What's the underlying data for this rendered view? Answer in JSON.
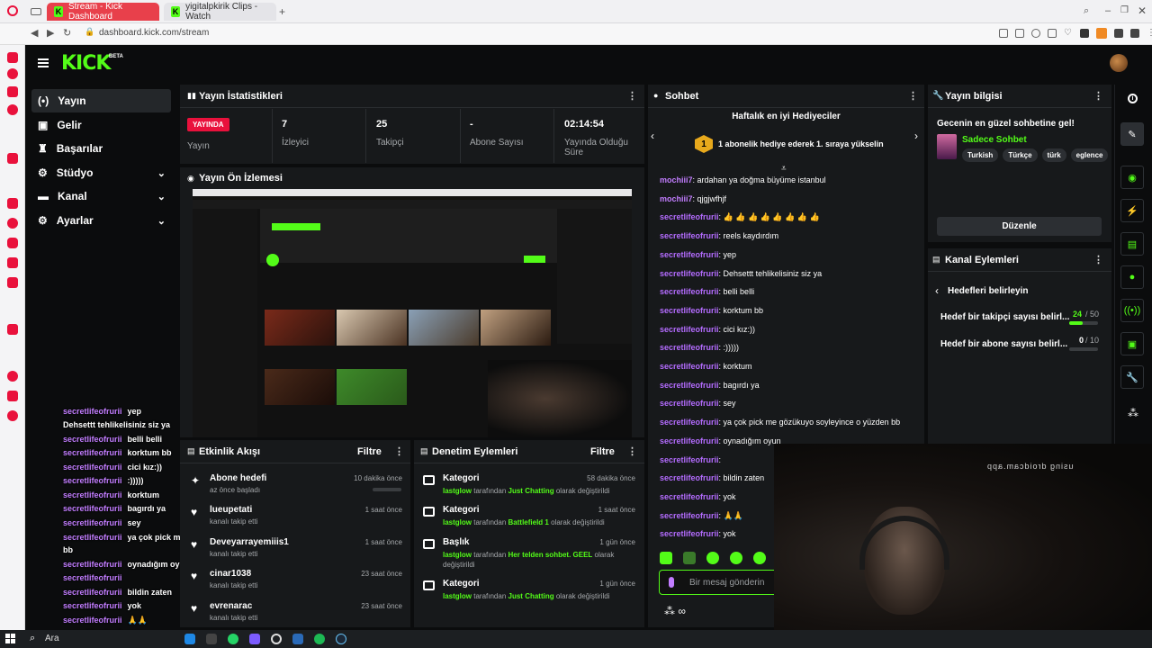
{
  "browser": {
    "tabs": [
      {
        "label": "Stream - Kick Dashboard",
        "active": true
      },
      {
        "label": "yigitalpkirik Clips - Watch"
      }
    ],
    "url": "dashboard.kick.com/stream"
  },
  "brand": {
    "logo": "KICK",
    "beta": "BETA",
    "accent": "#53fc18"
  },
  "nav": {
    "items": [
      {
        "label": "Yayın",
        "icon": "broadcast-icon",
        "active": true
      },
      {
        "label": "Gelir",
        "icon": "money-icon"
      },
      {
        "label": "Başarılar",
        "icon": "trophy-icon"
      },
      {
        "label": "Stüdyo",
        "icon": "gear-icon",
        "expand": true
      },
      {
        "label": "Kanal",
        "icon": "channel-icon",
        "expand": true
      },
      {
        "label": "Ayarlar",
        "icon": "settings-icon",
        "expand": true
      }
    ]
  },
  "stats": {
    "title": "Yayın İstatistikleri",
    "live_badge": "YAYINDA",
    "items": [
      {
        "value": "",
        "label": "Yayın"
      },
      {
        "value": "7",
        "label": "İzleyici"
      },
      {
        "value": "25",
        "label": "Takipçi"
      },
      {
        "value": "-",
        "label": "Abone Sayısı"
      },
      {
        "value": "02:14:54",
        "label": "Yayında Olduğu Süre"
      }
    ]
  },
  "preview": {
    "title": "Yayın Ön İzlemesi"
  },
  "activity": {
    "title": "Etkinlik Akışı",
    "filter": "Filtre",
    "events": [
      {
        "title": "Abone hedefi",
        "sub": "az önce başladı",
        "time": "10 dakika önce",
        "icon": "sparkle-icon"
      },
      {
        "title": "lueupetati",
        "sub": "kanalı takip etti",
        "time": "1 saat önce",
        "icon": "heart-icon"
      },
      {
        "title": "Deveyarrayemiiis1",
        "sub": "kanalı takip etti",
        "time": "1 saat önce",
        "icon": "heart-icon"
      },
      {
        "title": "cinar1038",
        "sub": "kanalı takip etti",
        "time": "23 saat önce",
        "icon": "heart-icon"
      },
      {
        "title": "evrenarac",
        "sub": "kanalı takip etti",
        "time": "23 saat önce",
        "icon": "heart-icon"
      }
    ]
  },
  "moderation": {
    "title": "Denetim Eylemleri",
    "filter": "Filtre",
    "items": [
      {
        "title": "Kategori",
        "time": "58 dakika önce",
        "user": "lastglow",
        "mid": "tarafından",
        "val": "Just Chatting",
        "end": "olarak değiştirildi"
      },
      {
        "title": "Kategori",
        "time": "1 saat önce",
        "user": "lastglow",
        "mid": "tarafından",
        "val": "Battlefield 1",
        "end": "olarak değiştirildi"
      },
      {
        "title": "Başlık",
        "time": "1 gün önce",
        "user": "lastglow",
        "mid": "tarafından",
        "val": "Her telden sohbet. GEEL",
        "end": "olarak değiştirildi"
      },
      {
        "title": "Kategori",
        "time": "1 gün önce",
        "user": "lastglow",
        "mid": "tarafından",
        "val": "Just Chatting",
        "end": "olarak değiştirildi"
      }
    ]
  },
  "chat": {
    "title": "Sohbet",
    "gifters_title": "Haftalık en iyi Hediyeciler",
    "gifters_rank": "1",
    "gifters_text": "1 abonelik hediye ederek 1. sıraya yükselin",
    "messages": [
      {
        "user": "mochiii7",
        "text": "ardahan ya doğma büyüme istanbul",
        "color": "#c27dff"
      },
      {
        "user": "mochiii7",
        "text": "qjgjwfhjf",
        "color": "#c27dff"
      },
      {
        "user": "secretlifeofrurii",
        "text": "👍 👍 👍 👍 👍 👍 👍 👍",
        "color": "#b46cff"
      },
      {
        "user": "secretlifeofrurii",
        "text": "reels kaydırdım",
        "color": "#b46cff"
      },
      {
        "user": "secretlifeofrurii",
        "text": "yep",
        "color": "#b46cff"
      },
      {
        "user": "secretlifeofrurii",
        "text": "Dehsettt tehlikelisiniz siz ya",
        "color": "#b46cff"
      },
      {
        "user": "secretlifeofrurii",
        "text": "belli belli",
        "color": "#b46cff"
      },
      {
        "user": "secretlifeofrurii",
        "text": "korktum bb",
        "color": "#b46cff"
      },
      {
        "user": "secretlifeofrurii",
        "text": "cici kız:))",
        "color": "#b46cff"
      },
      {
        "user": "secretlifeofrurii",
        "text": ":)))))",
        "color": "#b46cff"
      },
      {
        "user": "secretlifeofrurii",
        "text": "korktum",
        "color": "#b46cff"
      },
      {
        "user": "secretlifeofrurii",
        "text": "bagırdı ya",
        "color": "#b46cff"
      },
      {
        "user": "secretlifeofrurii",
        "text": "sey",
        "color": "#b46cff"
      },
      {
        "user": "secretlifeofrurii",
        "text": "ya çok pick me gözükuyo soyleyince o yüzden bb",
        "color": "#b46cff"
      },
      {
        "user": "secretlifeofrurii",
        "text": "oynadığım oyun",
        "color": "#b46cff"
      },
      {
        "user": "secretlifeofrurii",
        "text": "",
        "color": "#b46cff"
      },
      {
        "user": "secretlifeofrurii",
        "text": "bildin zaten",
        "color": "#b46cff"
      },
      {
        "user": "secretlifeofrurii",
        "text": "yok",
        "color": "#b46cff"
      },
      {
        "user": "secretlifeofrurii",
        "text": "🙏🙏",
        "color": "#b46cff"
      },
      {
        "user": "secretlifeofrurii",
        "text": "yok",
        "color": "#b46cff"
      }
    ],
    "placeholder": "Bir mesaj gönderin"
  },
  "streaminfo": {
    "title": "Yayın bilgisi",
    "stream_title": "Gecenin en güzel sohbetine gel!",
    "category": "Sadece Sohbet",
    "tags": [
      "Turkish",
      "Türkçe",
      "türk",
      "eglence"
    ],
    "edit": "Düzenle"
  },
  "channel_actions": {
    "title": "Kanal Eylemleri",
    "back": "Hedefleri belirleyin",
    "goals": [
      {
        "label": "Hedef bir takipçi sayısı belirl...",
        "current": "24",
        "total": "/ 50",
        "progress": 0.48
      },
      {
        "label": "Hedef bir abone sayısı belirl...",
        "current": "0",
        "total": "/ 10",
        "progress": 0
      }
    ]
  },
  "overlay_chat": [
    {
      "user": "secretlifeofrurii",
      "text": "yep"
    },
    {
      "user": "Dehsettt tehlikelisiniz siz ya",
      "text": ""
    },
    {
      "user": "secretlifeofrurii",
      "text": "belli belli"
    },
    {
      "user": "secretlifeofrurii",
      "text": "korktum bb"
    },
    {
      "user": "secretlifeofrurii",
      "text": "cici kız:))"
    },
    {
      "user": "secretlifeofrurii",
      "text": ":)))))"
    },
    {
      "user": "secretlifeofrurii",
      "text": "korktum"
    },
    {
      "user": "secretlifeofrurii",
      "text": "bagırdı ya"
    },
    {
      "user": "secretlifeofrurii",
      "text": "sey"
    },
    {
      "user": "secretlifeofrurii",
      "text": "ya çok pick me gözükuyo soyleyince o yüzden"
    },
    {
      "user": "bb",
      "text": ""
    },
    {
      "user": "secretlifeofrurii",
      "text": "oynadığım oyun"
    },
    {
      "user": "secretlifeofrurii",
      "text": ""
    },
    {
      "user": "secretlifeofrurii",
      "text": "bildin zaten"
    },
    {
      "user": "secretlifeofrurii",
      "text": "yok"
    },
    {
      "user": "secretlifeofrurii",
      "text": "🙏🙏"
    },
    {
      "user": "secretlifeofrurii",
      "text": "yok"
    }
  ],
  "webcam": {
    "watermark": "using droidcam.app"
  },
  "taskbar": {
    "search": "Ara"
  }
}
